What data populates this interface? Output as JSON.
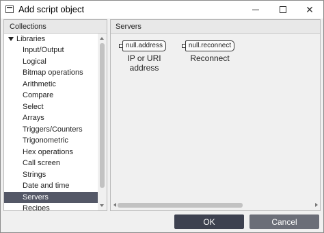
{
  "window": {
    "title": "Add script object",
    "icon": "dialog-window-icon"
  },
  "left_panel": {
    "header": "Collections",
    "root_label": "Libraries",
    "items": [
      {
        "label": "Input/Output"
      },
      {
        "label": "Logical"
      },
      {
        "label": "Bitmap operations"
      },
      {
        "label": "Arithmetic"
      },
      {
        "label": "Compare"
      },
      {
        "label": "Select"
      },
      {
        "label": "Arrays"
      },
      {
        "label": "Triggers/Counters"
      },
      {
        "label": "Trigonometric"
      },
      {
        "label": "Hex operations"
      },
      {
        "label": "Call screen"
      },
      {
        "label": "Strings"
      },
      {
        "label": "Date and time"
      },
      {
        "label": "Servers",
        "selected": true
      },
      {
        "label": "Recipes"
      }
    ]
  },
  "right_panel": {
    "header": "Servers",
    "objects": [
      {
        "box_text": "null.address",
        "label": "IP or URI address"
      },
      {
        "box_text": "null.reconnect",
        "label": "Reconnect"
      }
    ]
  },
  "buttons": {
    "ok": "OK",
    "cancel": "Cancel"
  },
  "colors": {
    "selection": "#545867",
    "ok_button": "#3d4150",
    "cancel_button": "#6b6e78"
  }
}
